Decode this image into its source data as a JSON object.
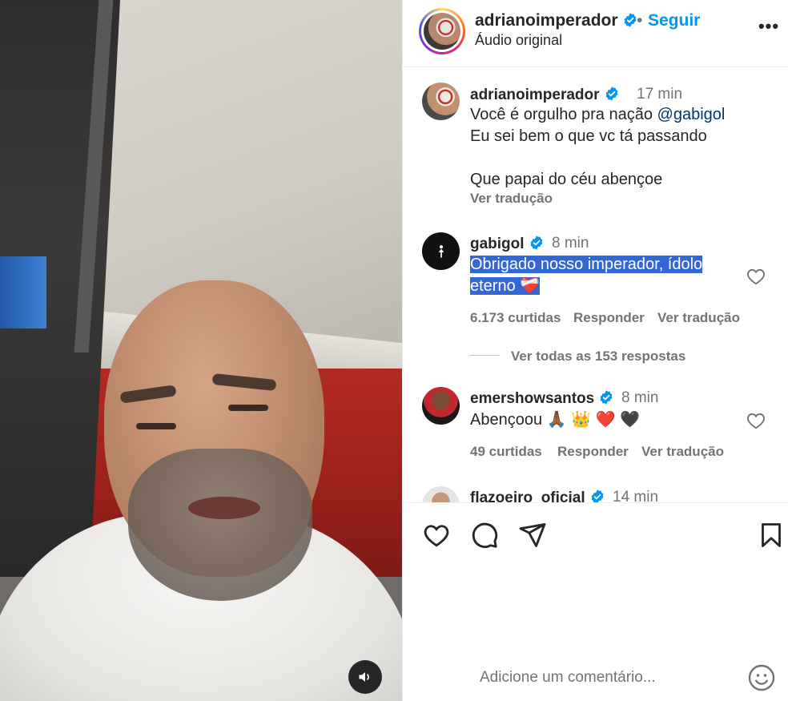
{
  "video": {
    "mute_icon": "speaker-icon"
  },
  "header": {
    "username": "adrianoimperador",
    "separator": "•",
    "follow_label": "Seguir",
    "audio_label": "Áudio original",
    "more_label": "•••"
  },
  "comments": [
    {
      "username": "adrianoimperador",
      "time": "17 min",
      "lines": [
        "Você é orgulho pra nação ",
        "Eu sei bem o que vc tá passando",
        "Que papai do céu abençoe"
      ],
      "mention": "@gabigol",
      "translate": "Ver tradução"
    },
    {
      "username": "gabigol",
      "time": "8 min",
      "lines": [
        "Obrigado nosso imperador, ídolo",
        "eterno ❤️‍🩹"
      ],
      "likes": "6.173 curtidas",
      "reply": "Responder",
      "translate": "Ver tradução",
      "view_replies": "Ver todas as 153 respostas"
    },
    {
      "username": "emershowsantos",
      "time": "8 min",
      "text": "Abençoou 🙏🏾 👑 ❤️ 🖤",
      "likes": "49 curtidas",
      "reply": "Responder",
      "translate": "Ver tradução"
    },
    {
      "username": "flazoeiro_oficial",
      "time": "14 min"
    }
  ],
  "actions": {
    "like_icon": "heart-icon",
    "comment_icon": "comment-icon",
    "share_icon": "share-icon",
    "save_icon": "bookmark-icon"
  },
  "comment_box": {
    "placeholder": "Adicione um comentário...",
    "emoji_icon": "emoji-icon"
  },
  "colors": {
    "link_blue": "#0095f6",
    "verified_blue": "#0095f6",
    "selection": "#3367d6",
    "meta_gray": "#737373"
  }
}
